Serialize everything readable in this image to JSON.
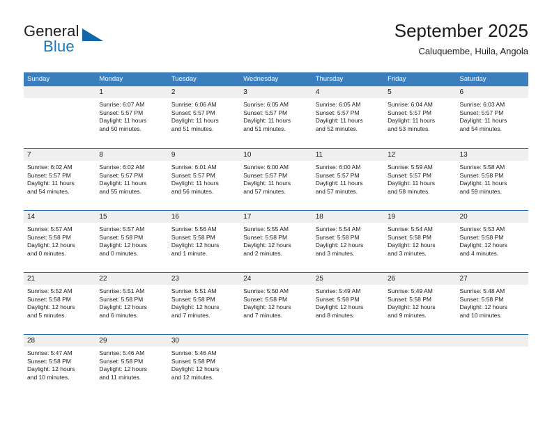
{
  "logo": {
    "primary_text": "General",
    "secondary_text": "Blue",
    "accent_color": "#1067a8"
  },
  "header": {
    "title": "September 2025",
    "subtitle": "Caluquembe, Huila, Angola"
  },
  "theme": {
    "header_bar_color": "#3a7ebe",
    "week_divider_color": "#1f6eb4",
    "day_number_band_color": "#efefef"
  },
  "weekdays": [
    "Sunday",
    "Monday",
    "Tuesday",
    "Wednesday",
    "Thursday",
    "Friday",
    "Saturday"
  ],
  "weeks": [
    [
      {
        "day": "",
        "empty": true
      },
      {
        "day": "1",
        "sunrise": "Sunrise: 6:07 AM",
        "sunset": "Sunset: 5:57 PM",
        "daylight_line1": "Daylight: 11 hours",
        "daylight_line2": "and 50 minutes."
      },
      {
        "day": "2",
        "sunrise": "Sunrise: 6:06 AM",
        "sunset": "Sunset: 5:57 PM",
        "daylight_line1": "Daylight: 11 hours",
        "daylight_line2": "and 51 minutes."
      },
      {
        "day": "3",
        "sunrise": "Sunrise: 6:05 AM",
        "sunset": "Sunset: 5:57 PM",
        "daylight_line1": "Daylight: 11 hours",
        "daylight_line2": "and 51 minutes."
      },
      {
        "day": "4",
        "sunrise": "Sunrise: 6:05 AM",
        "sunset": "Sunset: 5:57 PM",
        "daylight_line1": "Daylight: 11 hours",
        "daylight_line2": "and 52 minutes."
      },
      {
        "day": "5",
        "sunrise": "Sunrise: 6:04 AM",
        "sunset": "Sunset: 5:57 PM",
        "daylight_line1": "Daylight: 11 hours",
        "daylight_line2": "and 53 minutes."
      },
      {
        "day": "6",
        "sunrise": "Sunrise: 6:03 AM",
        "sunset": "Sunset: 5:57 PM",
        "daylight_line1": "Daylight: 11 hours",
        "daylight_line2": "and 54 minutes."
      }
    ],
    [
      {
        "day": "7",
        "sunrise": "Sunrise: 6:02 AM",
        "sunset": "Sunset: 5:57 PM",
        "daylight_line1": "Daylight: 11 hours",
        "daylight_line2": "and 54 minutes."
      },
      {
        "day": "8",
        "sunrise": "Sunrise: 6:02 AM",
        "sunset": "Sunset: 5:57 PM",
        "daylight_line1": "Daylight: 11 hours",
        "daylight_line2": "and 55 minutes."
      },
      {
        "day": "9",
        "sunrise": "Sunrise: 6:01 AM",
        "sunset": "Sunset: 5:57 PM",
        "daylight_line1": "Daylight: 11 hours",
        "daylight_line2": "and 56 minutes."
      },
      {
        "day": "10",
        "sunrise": "Sunrise: 6:00 AM",
        "sunset": "Sunset: 5:57 PM",
        "daylight_line1": "Daylight: 11 hours",
        "daylight_line2": "and 57 minutes."
      },
      {
        "day": "11",
        "sunrise": "Sunrise: 6:00 AM",
        "sunset": "Sunset: 5:57 PM",
        "daylight_line1": "Daylight: 11 hours",
        "daylight_line2": "and 57 minutes."
      },
      {
        "day": "12",
        "sunrise": "Sunrise: 5:59 AM",
        "sunset": "Sunset: 5:57 PM",
        "daylight_line1": "Daylight: 11 hours",
        "daylight_line2": "and 58 minutes."
      },
      {
        "day": "13",
        "sunrise": "Sunrise: 5:58 AM",
        "sunset": "Sunset: 5:58 PM",
        "daylight_line1": "Daylight: 11 hours",
        "daylight_line2": "and 59 minutes."
      }
    ],
    [
      {
        "day": "14",
        "sunrise": "Sunrise: 5:57 AM",
        "sunset": "Sunset: 5:58 PM",
        "daylight_line1": "Daylight: 12 hours",
        "daylight_line2": "and 0 minutes."
      },
      {
        "day": "15",
        "sunrise": "Sunrise: 5:57 AM",
        "sunset": "Sunset: 5:58 PM",
        "daylight_line1": "Daylight: 12 hours",
        "daylight_line2": "and 0 minutes."
      },
      {
        "day": "16",
        "sunrise": "Sunrise: 5:56 AM",
        "sunset": "Sunset: 5:58 PM",
        "daylight_line1": "Daylight: 12 hours",
        "daylight_line2": "and 1 minute."
      },
      {
        "day": "17",
        "sunrise": "Sunrise: 5:55 AM",
        "sunset": "Sunset: 5:58 PM",
        "daylight_line1": "Daylight: 12 hours",
        "daylight_line2": "and 2 minutes."
      },
      {
        "day": "18",
        "sunrise": "Sunrise: 5:54 AM",
        "sunset": "Sunset: 5:58 PM",
        "daylight_line1": "Daylight: 12 hours",
        "daylight_line2": "and 3 minutes."
      },
      {
        "day": "19",
        "sunrise": "Sunrise: 5:54 AM",
        "sunset": "Sunset: 5:58 PM",
        "daylight_line1": "Daylight: 12 hours",
        "daylight_line2": "and 3 minutes."
      },
      {
        "day": "20",
        "sunrise": "Sunrise: 5:53 AM",
        "sunset": "Sunset: 5:58 PM",
        "daylight_line1": "Daylight: 12 hours",
        "daylight_line2": "and 4 minutes."
      }
    ],
    [
      {
        "day": "21",
        "sunrise": "Sunrise: 5:52 AM",
        "sunset": "Sunset: 5:58 PM",
        "daylight_line1": "Daylight: 12 hours",
        "daylight_line2": "and 5 minutes."
      },
      {
        "day": "22",
        "sunrise": "Sunrise: 5:51 AM",
        "sunset": "Sunset: 5:58 PM",
        "daylight_line1": "Daylight: 12 hours",
        "daylight_line2": "and 6 minutes."
      },
      {
        "day": "23",
        "sunrise": "Sunrise: 5:51 AM",
        "sunset": "Sunset: 5:58 PM",
        "daylight_line1": "Daylight: 12 hours",
        "daylight_line2": "and 7 minutes."
      },
      {
        "day": "24",
        "sunrise": "Sunrise: 5:50 AM",
        "sunset": "Sunset: 5:58 PM",
        "daylight_line1": "Daylight: 12 hours",
        "daylight_line2": "and 7 minutes."
      },
      {
        "day": "25",
        "sunrise": "Sunrise: 5:49 AM",
        "sunset": "Sunset: 5:58 PM",
        "daylight_line1": "Daylight: 12 hours",
        "daylight_line2": "and 8 minutes."
      },
      {
        "day": "26",
        "sunrise": "Sunrise: 5:49 AM",
        "sunset": "Sunset: 5:58 PM",
        "daylight_line1": "Daylight: 12 hours",
        "daylight_line2": "and 9 minutes."
      },
      {
        "day": "27",
        "sunrise": "Sunrise: 5:48 AM",
        "sunset": "Sunset: 5:58 PM",
        "daylight_line1": "Daylight: 12 hours",
        "daylight_line2": "and 10 minutes."
      }
    ],
    [
      {
        "day": "28",
        "sunrise": "Sunrise: 5:47 AM",
        "sunset": "Sunset: 5:58 PM",
        "daylight_line1": "Daylight: 12 hours",
        "daylight_line2": "and 10 minutes."
      },
      {
        "day": "29",
        "sunrise": "Sunrise: 5:46 AM",
        "sunset": "Sunset: 5:58 PM",
        "daylight_line1": "Daylight: 12 hours",
        "daylight_line2": "and 11 minutes."
      },
      {
        "day": "30",
        "sunrise": "Sunrise: 5:46 AM",
        "sunset": "Sunset: 5:58 PM",
        "daylight_line1": "Daylight: 12 hours",
        "daylight_line2": "and 12 minutes."
      },
      {
        "day": "",
        "empty": true
      },
      {
        "day": "",
        "empty": true
      },
      {
        "day": "",
        "empty": true
      },
      {
        "day": "",
        "empty": true
      }
    ]
  ]
}
